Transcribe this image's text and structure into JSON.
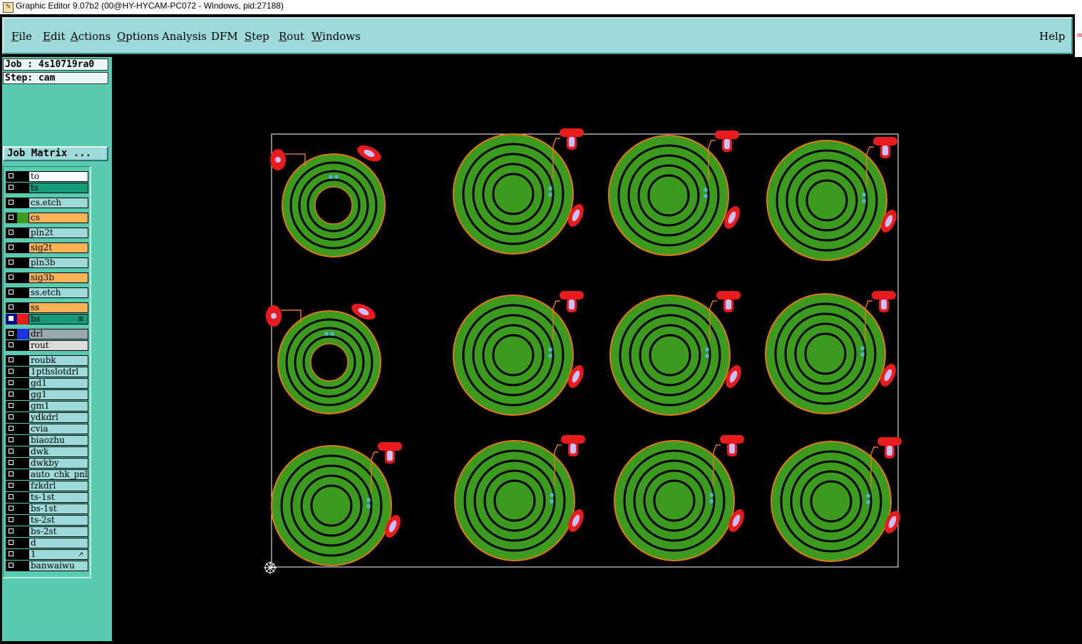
{
  "window": {
    "title": "Graphic Editor 9.07b2 (00@HY-HYCAM-PC072 - Windows, pid:27188)"
  },
  "menu": {
    "items": [
      {
        "label": "File",
        "key": "F"
      },
      {
        "label": "Edit",
        "key": "E"
      },
      {
        "label": "Actions",
        "key": "A"
      },
      {
        "label": "Options",
        "key": "O"
      },
      {
        "label": "Analysis",
        "key": ""
      },
      {
        "label": "DFM",
        "key": ""
      },
      {
        "label": "Step",
        "key": "S"
      },
      {
        "label": "Rout",
        "key": "R"
      },
      {
        "label": "Windows",
        "key": "W"
      }
    ],
    "help": "Help"
  },
  "job": {
    "job_label": "Job : 4s10719ra0",
    "step_label": "Step: cam",
    "matrix_button": "Job Matrix ..."
  },
  "colors": {
    "panel": "#58cbb0",
    "menu": "#9edada",
    "board_outline": "#ffffff",
    "copper": "#3c9a1e",
    "trace_outline": "#e07818",
    "pad": "#e81c1c",
    "via": "#4ab6c8"
  },
  "layers": [
    {
      "name": "to",
      "bg": "#ffffff",
      "swatch": "#000000",
      "active": false,
      "mark": ""
    },
    {
      "name": "ts",
      "bg": "#179a77",
      "swatch": "#000000",
      "active": false,
      "mark": ""
    },
    {
      "name": "cs.etch",
      "bg": "#9edada",
      "swatch": "#000000",
      "active": false,
      "mark": ""
    },
    {
      "name": "cs",
      "bg": "#f9b354",
      "swatch": "#3c9a1e",
      "active": false,
      "mark": ""
    },
    {
      "name": "pln2t",
      "bg": "#9edada",
      "swatch": "#000000",
      "active": false,
      "mark": ""
    },
    {
      "name": "sig2t",
      "bg": "#f9b354",
      "swatch": "#000000",
      "active": false,
      "mark": ""
    },
    {
      "name": "pln3b",
      "bg": "#9edada",
      "swatch": "#000000",
      "active": false,
      "mark": ""
    },
    {
      "name": "sig3b",
      "bg": "#f9b354",
      "swatch": "#000000",
      "active": false,
      "mark": ""
    },
    {
      "name": "ss.etch",
      "bg": "#9edada",
      "swatch": "#000000",
      "active": false,
      "mark": ""
    },
    {
      "name": "ss",
      "bg": "#f9b354",
      "swatch": "#000000",
      "active": false,
      "mark": ""
    },
    {
      "name": "bs",
      "bg": "#179a77",
      "swatch": "#e81c1c",
      "active": true,
      "mark": "⊞"
    },
    {
      "name": "drl",
      "bg": "#9aaab0",
      "swatch": "#1c33e0",
      "active": false,
      "mark": ""
    },
    {
      "name": "rout",
      "bg": "#dcdcdc",
      "swatch": "#000000",
      "active": false,
      "mark": ""
    },
    {
      "name": "roubk",
      "bg": "#9edada",
      "swatch": "#000000",
      "active": false,
      "mark": ""
    },
    {
      "name": "1pthslotdrl",
      "bg": "#9edada",
      "swatch": "#000000",
      "active": false,
      "mark": ""
    },
    {
      "name": "gd1",
      "bg": "#9edada",
      "swatch": "#000000",
      "active": false,
      "mark": ""
    },
    {
      "name": "gg1",
      "bg": "#9edada",
      "swatch": "#000000",
      "active": false,
      "mark": ""
    },
    {
      "name": "gm1",
      "bg": "#9edada",
      "swatch": "#000000",
      "active": false,
      "mark": ""
    },
    {
      "name": "ydkdrl",
      "bg": "#9edada",
      "swatch": "#000000",
      "active": false,
      "mark": ""
    },
    {
      "name": "cvia",
      "bg": "#9edada",
      "swatch": "#000000",
      "active": false,
      "mark": ""
    },
    {
      "name": "biaozhu",
      "bg": "#9edada",
      "swatch": "#000000",
      "active": false,
      "mark": ""
    },
    {
      "name": "dwk",
      "bg": "#9edada",
      "swatch": "#000000",
      "active": false,
      "mark": ""
    },
    {
      "name": "dwkby",
      "bg": "#9edada",
      "swatch": "#000000",
      "active": false,
      "mark": ""
    },
    {
      "name": "auto_chk_pnl",
      "bg": "#9edada",
      "swatch": "#000000",
      "active": false,
      "mark": ""
    },
    {
      "name": "fzkdrl",
      "bg": "#9edada",
      "swatch": "#000000",
      "active": false,
      "mark": ""
    },
    {
      "name": "ts-1st",
      "bg": "#9edada",
      "swatch": "#000000",
      "active": false,
      "mark": ""
    },
    {
      "name": "bs-1st",
      "bg": "#9edada",
      "swatch": "#000000",
      "active": false,
      "mark": ""
    },
    {
      "name": "ts-2st",
      "bg": "#9edada",
      "swatch": "#000000",
      "active": false,
      "mark": ""
    },
    {
      "name": "bs-2st",
      "bg": "#9edada",
      "swatch": "#000000",
      "active": false,
      "mark": ""
    },
    {
      "name": "d",
      "bg": "#9edada",
      "swatch": "#000000",
      "active": false,
      "mark": ""
    },
    {
      "name": "1",
      "bg": "#9edada",
      "swatch": "#000000",
      "active": false,
      "mark": "↗"
    },
    {
      "name": "banwaiwu",
      "bg": "#9edada",
      "swatch": "#000000",
      "active": false,
      "mark": ""
    }
  ],
  "board": {
    "rows": 3,
    "cols": 4,
    "layout_note": "3x4 panel of spiral coil units; two small coils at left of first two rows"
  }
}
